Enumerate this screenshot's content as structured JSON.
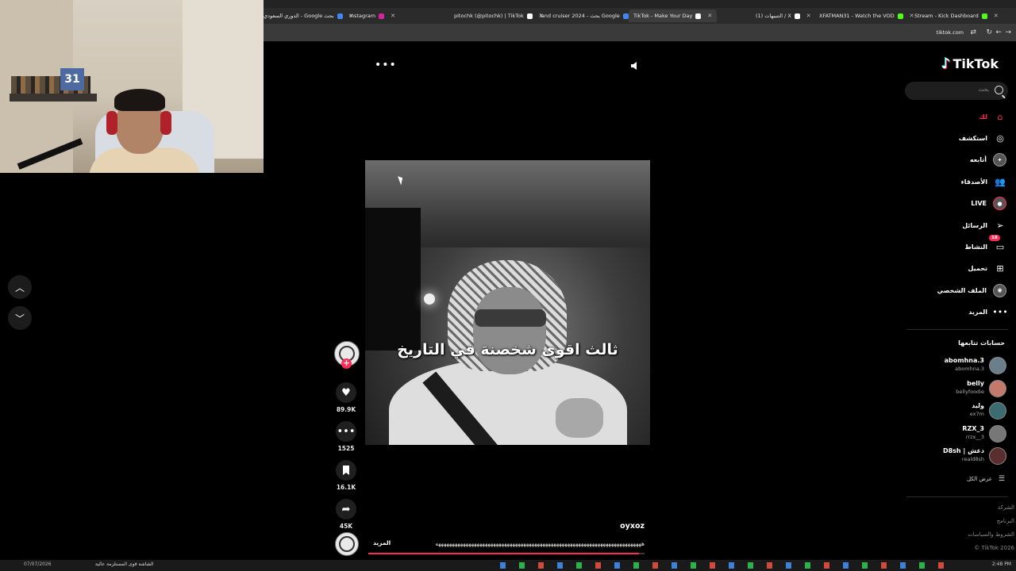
{
  "browser": {
    "tabs": [
      {
        "title": "الدوري السعودي - Google بحث",
        "favicon": "google-icon",
        "color": "#4285f4"
      },
      {
        "title": "Instagram",
        "favicon": "instagram-icon",
        "color": "#d6249f"
      },
      {
        "title": "pitochk (@pitochk) | TikTok",
        "favicon": "tiktok-icon",
        "color": "#ffffff"
      },
      {
        "title": "land cruiser 2024 - بحث Google",
        "favicon": "google-icon",
        "color": "#4285f4"
      },
      {
        "title": "TikTok - Make Your Day",
        "favicon": "tiktok-icon",
        "color": "#ffffff",
        "active": true
      },
      {
        "title": "(1) التنبيهات / X",
        "favicon": "x-icon",
        "color": "#ffffff"
      },
      {
        "title": "XFATMAN31 - Watch the VOD",
        "favicon": "kick-icon",
        "color": "#53fc18"
      },
      {
        "title": "Stream - Kick Dashboard",
        "favicon": "kick-icon",
        "color": "#53fc18"
      }
    ],
    "url": "tiktok.com"
  },
  "video": {
    "caption": "ثالث اقوى شخصنة في التاريخ",
    "author": "oyxoz",
    "description": "هههههههههههههههههههههههههههههههههههههههههههههههههههههههههههههههههههههههههههه",
    "more_label": "المزيد",
    "progress": 0.98
  },
  "actions": {
    "likes": "89.9K",
    "comments": "1525",
    "bookmarks": "16.1K",
    "shares": "45K"
  },
  "sidebar": {
    "logo": "TikTok",
    "search_placeholder": "بحث",
    "nav": [
      {
        "label": "لك",
        "icon": "home-icon",
        "active": true
      },
      {
        "label": "استكشف",
        "icon": "compass-icon"
      },
      {
        "label": "أتابعه",
        "icon": "following-avatar-icon"
      },
      {
        "label": "الأصدقاء",
        "icon": "friends-icon"
      },
      {
        "label": "LIVE",
        "icon": "live-icon"
      },
      {
        "label": "الرسائل",
        "icon": "messages-icon"
      },
      {
        "label": "النشاط",
        "icon": "activity-icon",
        "badge": "18"
      },
      {
        "label": "تحميل",
        "icon": "upload-icon"
      },
      {
        "label": "الملف الشخصي",
        "icon": "profile-icon"
      },
      {
        "label": "المزيد",
        "icon": "more-icon"
      }
    ],
    "following_title": "حسابات تتابعها",
    "following": [
      {
        "name": "abomhna.3",
        "handle": "abomhna.3"
      },
      {
        "name": "belly",
        "handle": "bellyfoodie"
      },
      {
        "name": "وليد",
        "handle": "ex7m"
      },
      {
        "name": "RZX_3",
        "handle": "rrzx__3"
      },
      {
        "name": "D8sh | دغش",
        "handle": "reald8sh"
      }
    ],
    "see_all": "عرض الكل",
    "footer": [
      "الشركة",
      "البرنامج",
      "الشروط والسياسات",
      "TikTok 2026 ©"
    ]
  },
  "taskbar": {
    "left_text": "07/07/2026",
    "item_text": "الشاشة قوى المستلزمة عالية",
    "right_text": "2:48 PM"
  }
}
